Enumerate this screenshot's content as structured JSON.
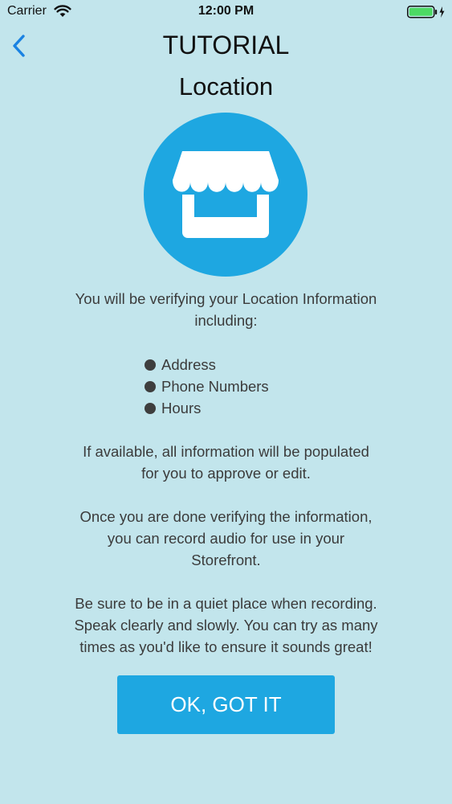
{
  "status_bar": {
    "carrier": "Carrier",
    "time": "12:00 PM",
    "wifi_icon": "wifi-icon",
    "battery_icon": "battery-charging-icon",
    "battery_color": "#4cd964"
  },
  "nav": {
    "back_icon": "chevron-left-icon",
    "accent_color": "#1a82e2"
  },
  "header": {
    "title": "TUTORIAL",
    "subtitle": "Location"
  },
  "hero": {
    "icon": "storefront-icon",
    "circle_color": "#1ea7e1"
  },
  "content": {
    "intro_line1": "You will be verifying your Location Information",
    "intro_line2": "including:",
    "bullets": [
      "Address",
      "Phone Numbers",
      "Hours"
    ],
    "para1_line1": "If available, all information will be populated",
    "para1_line2": "for you to approve or edit.",
    "para2_line1": "Once you are done verifying the information,",
    "para2_line2": "you can record audio for use in your",
    "para2_line3": "Storefront.",
    "para3_line1": "Be sure to be in a quiet place when recording.",
    "para3_line2": "Speak clearly and slowly. You can try as many",
    "para3_line3": "times as you'd like to ensure it sounds great!"
  },
  "actions": {
    "ok_label": "OK, GOT IT",
    "button_color": "#1ea7e1"
  }
}
